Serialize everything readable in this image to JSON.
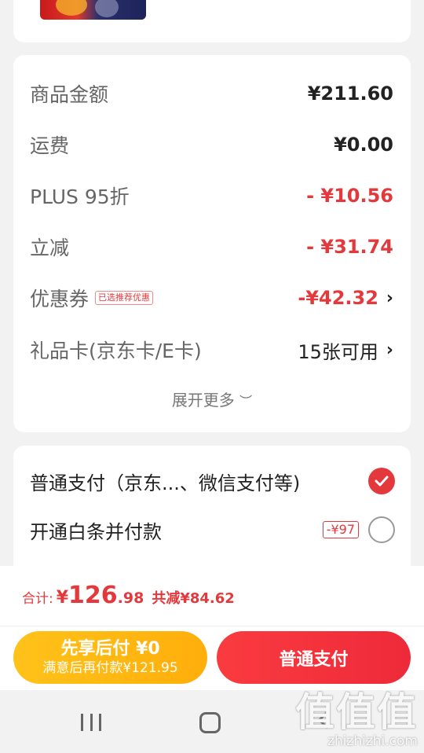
{
  "price_summary": {
    "rows": [
      {
        "label": "商品金额",
        "value": "¥211.60"
      },
      {
        "label": "运费",
        "value": "¥0.00"
      },
      {
        "label": "PLUS 95折",
        "value": "- ¥10.56"
      },
      {
        "label": "立减",
        "value": "- ¥31.74"
      },
      {
        "label": "优惠券",
        "tag": "已选推荐优惠",
        "value": "-¥42.32"
      },
      {
        "label": "礼品卡(京东卡/E卡)",
        "value": "15张可用"
      }
    ],
    "expand_label": "展开更多",
    "expand_icon": "chevron-down-icon"
  },
  "payment": {
    "options": [
      {
        "label": "普通支付（京东...、微信支付等)",
        "selected": true
      },
      {
        "label": "开通白条并付款",
        "discount_tag": "-¥97",
        "selected": false
      }
    ]
  },
  "totals": {
    "label": "合计:",
    "currency": "¥",
    "amount_main": "126",
    "amount_decimal": ".98",
    "saved": "共减¥84.62"
  },
  "buttons": {
    "pay_later_title": "先享后付 ¥0",
    "pay_later_sub": "满意后再付款¥121.95",
    "normal_pay": "普通支付"
  },
  "watermark": {
    "mark": "值值值",
    "url": "zhizhizhi.com"
  },
  "colors": {
    "accent_red": "#e4393c",
    "pay_later_yellow": "#ffb812",
    "background": "#f2f2f2"
  }
}
